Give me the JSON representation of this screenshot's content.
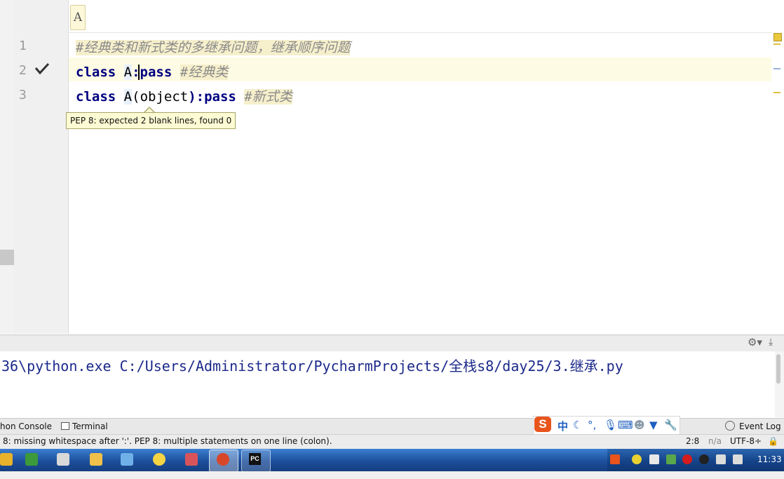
{
  "editor": {
    "breadcrumb": "A",
    "line_numbers": [
      "1",
      "2",
      "3"
    ],
    "line1_comment": "#经典类和新式类的多继承问题，继承顺序问题",
    "line2": {
      "kw": "class",
      "name": "A",
      "rest": ":pass",
      "comment": "#经典类"
    },
    "line3": {
      "kw": "class",
      "name": "A",
      "paren_open": "(",
      "base": "object",
      "rest": "):pass",
      "comment": "#新式类"
    },
    "tooltip": "PEP 8: expected 2 blank lines, found 0",
    "gutter_check_icon": "checkmark-icon",
    "text_cursor_icon": "i-beam-icon"
  },
  "console": {
    "command": "36\\python.exe C:/Users/Administrator/PycharmProjects/全栈s8/day25/3.继承.py"
  },
  "tool_tabs": {
    "python_console": "hon Console",
    "terminal": "Terminal",
    "event_log": "Event Log"
  },
  "ime": {
    "logo": "S",
    "mode": "中",
    "icons": [
      "moon-icon",
      "punctuation-icon",
      "microphone-icon",
      "keyboard-icon",
      "user-icon",
      "shirt-icon",
      "wrench-icon"
    ]
  },
  "status_bar": {
    "message": "8: missing whitespace after ':'. PEP 8: multiple statements on one line (colon).",
    "position": "2:8",
    "na": "n/a",
    "encoding": "UTF-8÷"
  },
  "taskbar": {
    "pinned_icons": [
      "app-icon",
      "flag-icon",
      "windows-icon",
      "camera-icon",
      "paint-icon",
      "smiley-icon",
      "bird-icon",
      "app-active-icon",
      "pycharm-icon"
    ],
    "pycharm_label": "PC",
    "tray_icons": [
      "sogou-icon",
      "plus-icon",
      "network-icon",
      "flag-icon",
      "record-icon",
      "qq-icon",
      "monitor-icon",
      "volume-icon"
    ],
    "clock": "11:33"
  },
  "colors": {
    "keyword": "#000080",
    "comment": "#8a8a8a",
    "comment_bg": "#f6efcc",
    "console_text": "#1c2a8a",
    "taskbar": "#1c4f9c"
  }
}
